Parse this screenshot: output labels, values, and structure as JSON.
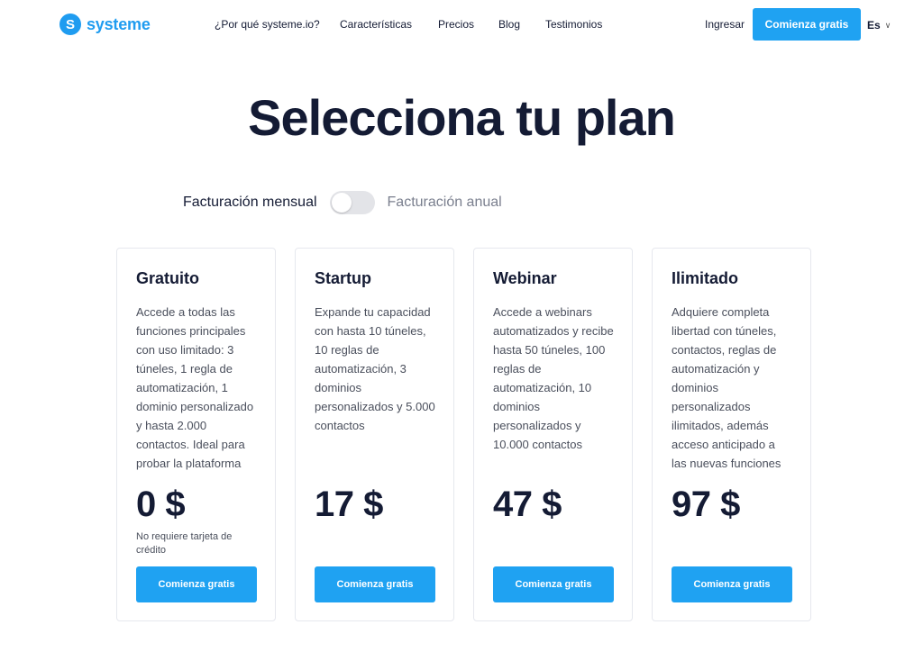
{
  "header": {
    "logo_text": "systeme",
    "logo_mark": "S",
    "nav": [
      "¿Por qué systeme.io?",
      "Características",
      "Precios",
      "Blog",
      "Testimonios"
    ],
    "signin_label": "Ingresar",
    "cta_label": "Comienza gratis",
    "language": "Es"
  },
  "title": "Selecciona tu plan",
  "billing": {
    "monthly_label": "Facturación mensual",
    "annual_label": "Facturación anual",
    "annual_selected": false
  },
  "plans": [
    {
      "name": "Gratuito",
      "description": "Accede a todas las funciones principales con uso limitado: 3 túneles, 1 regla de automatización, 1 dominio personalizado y hasta 2.000 contactos. Ideal para probar la plataforma",
      "price": "0 $",
      "note": "No requiere tarjeta de crédito",
      "cta_label": "Comienza gratis"
    },
    {
      "name": "Startup",
      "description": "Expande tu capacidad con hasta 10 túneles, 10 reglas de automatización, 3 dominios personalizados y 5.000 contactos",
      "price": "17 $",
      "note": "",
      "cta_label": "Comienza gratis"
    },
    {
      "name": "Webinar",
      "description": "Accede a webinars automatizados y recibe hasta 50 túneles, 100 reglas de automatización, 10 dominios personalizados y 10.000 contactos",
      "price": "47 $",
      "note": "",
      "cta_label": "Comienza gratis"
    },
    {
      "name": "Ilimitado",
      "description": "Adquiere completa libertad con túneles, contactos, reglas de automatización y dominios personalizados ilimitados, además acceso anticipado a las nuevas funciones",
      "price": "97 $",
      "note": "",
      "cta_label": "Comienza gratis"
    }
  ],
  "colors": {
    "brand": "#1f9cf0",
    "button": "#1fa2f2",
    "text_dark": "#141b34",
    "text_muted": "#4a4f5c"
  }
}
